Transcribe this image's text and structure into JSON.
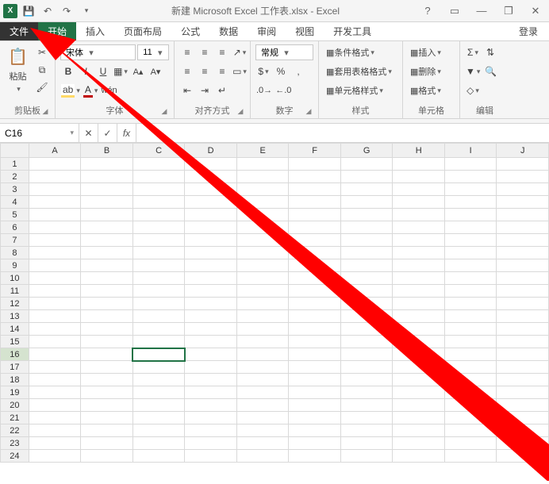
{
  "titlebar": {
    "title": "新建 Microsoft Excel 工作表.xlsx - Excel",
    "save_icon": "save-icon",
    "undo_icon": "undo-icon",
    "redo_icon": "redo-icon"
  },
  "sysbuttons": {
    "help": "?",
    "ribbon_opts": "▭",
    "minimize": "—",
    "restore": "❐",
    "close": "✕"
  },
  "tabs": {
    "file": "文件",
    "home": "开始",
    "insert": "插入",
    "page_layout": "页面布局",
    "formulas": "公式",
    "data": "数据",
    "review": "审阅",
    "view": "视图",
    "developer": "开发工具",
    "login": "登录"
  },
  "ribbon": {
    "clipboard": {
      "paste": "粘贴",
      "label": "剪贴板"
    },
    "font": {
      "name": "宋体",
      "size": "11",
      "label": "字体",
      "b": "B",
      "i": "I",
      "u": "U"
    },
    "alignment": {
      "label": "对齐方式"
    },
    "number": {
      "format": "常规",
      "label": "数字",
      "percent": "%",
      "comma": ","
    },
    "styles": {
      "cond": "条件格式",
      "table": "套用表格格式",
      "cell": "单元格样式",
      "label": "样式"
    },
    "cells": {
      "insert": "插入",
      "delete": "删除",
      "format": "格式",
      "label": "单元格"
    },
    "editing": {
      "sum": "Σ",
      "label": "编辑"
    }
  },
  "formula_bar": {
    "namebox": "C16",
    "fx": "fx",
    "value": ""
  },
  "grid": {
    "cols": [
      "A",
      "B",
      "C",
      "D",
      "E",
      "F",
      "G",
      "H",
      "I",
      "J"
    ],
    "rows": [
      1,
      2,
      3,
      4,
      5,
      6,
      7,
      8,
      9,
      10,
      11,
      12,
      13,
      14,
      15,
      16,
      17,
      18,
      19,
      20,
      21,
      22,
      23,
      24
    ],
    "selected_row": 16,
    "selected_col": "C"
  }
}
